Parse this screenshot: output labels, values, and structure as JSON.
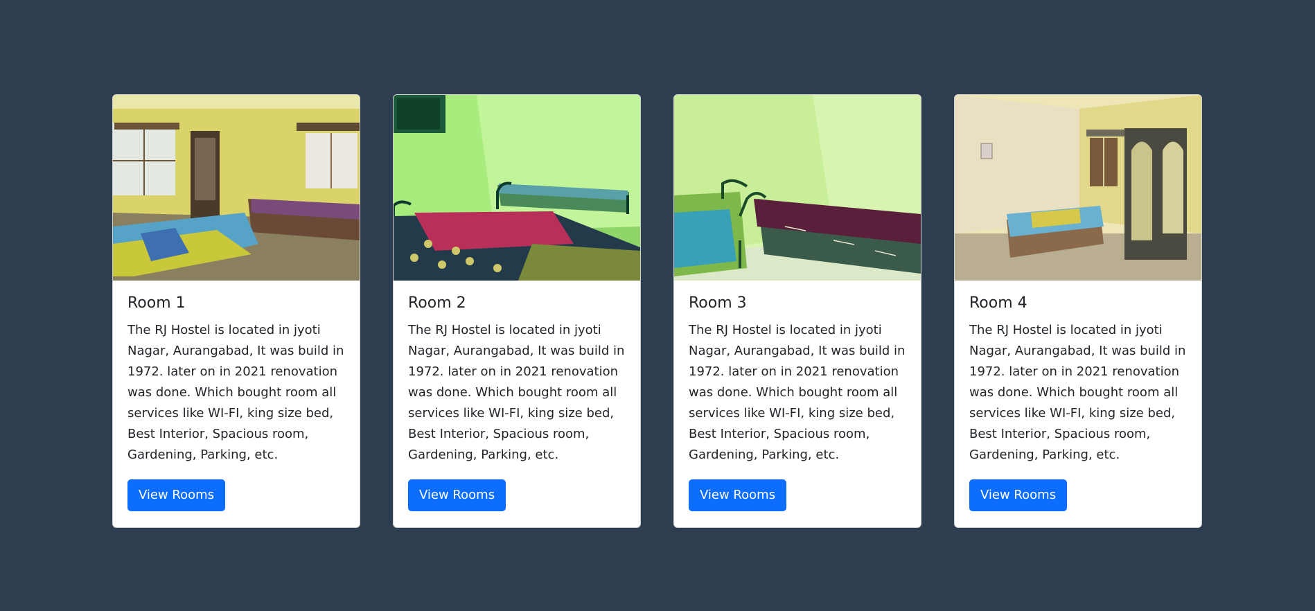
{
  "rooms": [
    {
      "title": "Room 1",
      "description": "The RJ Hostel is located in jyoti Nagar, Aurangabad, It was build in 1972. later on in 2021 renovation was done. Which bought room all services like WI-FI, king size bed, Best Interior, Spacious room, Gardening, Parking, etc.",
      "button": "View Rooms",
      "photo_icon": "room-photo-yellow-walls-two-beds"
    },
    {
      "title": "Room 2",
      "description": "The RJ Hostel is located in jyoti Nagar, Aurangabad, It was build in 1972. later on in 2021 renovation was done. Which bought room all services like WI-FI, king size bed, Best Interior, Spacious room, Gardening, Parking, etc.",
      "button": "View Rooms",
      "photo_icon": "room-photo-green-walls-two-beds"
    },
    {
      "title": "Room 3",
      "description": "The RJ Hostel is located in jyoti Nagar, Aurangabad, It was build in 1972. later on in 2021 renovation was done. Which bought room all services like WI-FI, king size bed, Best Interior, Spacious room, Gardening, Parking, etc.",
      "button": "View Rooms",
      "photo_icon": "room-photo-light-green-walls-two-beds"
    },
    {
      "title": "Room 4",
      "description": "The RJ Hostel is located in jyoti Nagar, Aurangabad, It was build in 1972. later on in 2021 renovation was done. Which bought room all services like WI-FI, king size bed, Best Interior, Spacious room, Gardening, Parking, etc.",
      "button": "View Rooms",
      "photo_icon": "room-photo-cream-walls-bed-wardrobe"
    }
  ],
  "colors": {
    "background": "#2d3e50",
    "card": "#ffffff",
    "button": "#0d6efd",
    "text": "#212529"
  }
}
